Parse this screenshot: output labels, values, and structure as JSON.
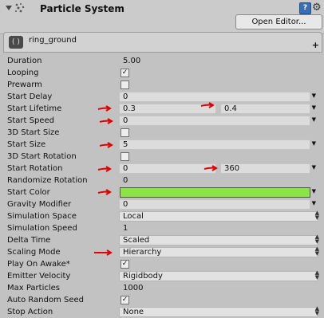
{
  "header": {
    "title": "Particle System",
    "open_editor_label": "Open Editor...",
    "help_glyph": "?",
    "gear_glyph": "⚙"
  },
  "module": {
    "name": "ring_ground",
    "icon_glyph": "( )",
    "plus_glyph": "+"
  },
  "properties": [
    {
      "label": "Duration",
      "value": "5.00"
    },
    {
      "label": "Looping",
      "checked": "✓"
    },
    {
      "label": "Prewarm",
      "checked": ""
    },
    {
      "label": "Start Delay",
      "value": "0"
    },
    {
      "label": "Start Lifetime",
      "value": "0.3",
      "value2": "0.4"
    },
    {
      "label": "Start Speed",
      "value": "0"
    },
    {
      "label": "3D Start Size",
      "checked": ""
    },
    {
      "label": "Start Size",
      "value": "5"
    },
    {
      "label": "3D Start Rotation",
      "checked": ""
    },
    {
      "label": "Start Rotation",
      "value": "0",
      "value2": "360"
    },
    {
      "label": "Randomize Rotation",
      "value": "0"
    },
    {
      "label": "Start Color",
      "color": "#8ce444"
    },
    {
      "label": "Gravity Modifier",
      "value": "0"
    },
    {
      "label": "Simulation Space",
      "value": "Local"
    },
    {
      "label": "Simulation Speed",
      "value": "1"
    },
    {
      "label": "Delta Time",
      "value": "Scaled"
    },
    {
      "label": "Scaling Mode",
      "value": "Hierarchy"
    },
    {
      "label": "Play On Awake*",
      "checked": "✓"
    },
    {
      "label": "Emitter Velocity",
      "value": "Rigidbody"
    },
    {
      "label": "Max Particles",
      "value": "1000"
    },
    {
      "label": "Auto Random Seed",
      "checked": "✓"
    },
    {
      "label": "Stop Action",
      "value": "None"
    }
  ],
  "annotation_color": "#e00000"
}
